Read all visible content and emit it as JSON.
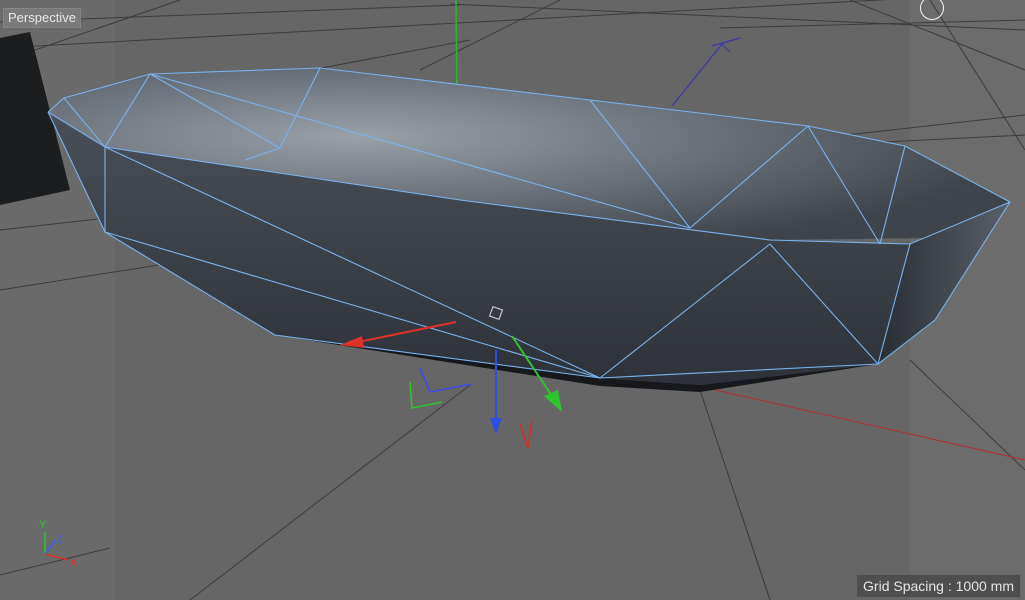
{
  "viewport": {
    "label": "Perspective",
    "grid_spacing": "Grid Spacing : 1000 mm"
  },
  "world_axis": {
    "x_label": "X",
    "y_label": "Y",
    "z_label": "Z"
  },
  "colors": {
    "axis_x": "#e0302a",
    "axis_y": "#2ec42e",
    "axis_z": "#2e4ee6",
    "wireframe": "#6fa8e8",
    "background": "#6a6a6a"
  },
  "icons": {
    "camera_handle": "circle-icon",
    "object_axis": "axis-gizmo-icon"
  }
}
